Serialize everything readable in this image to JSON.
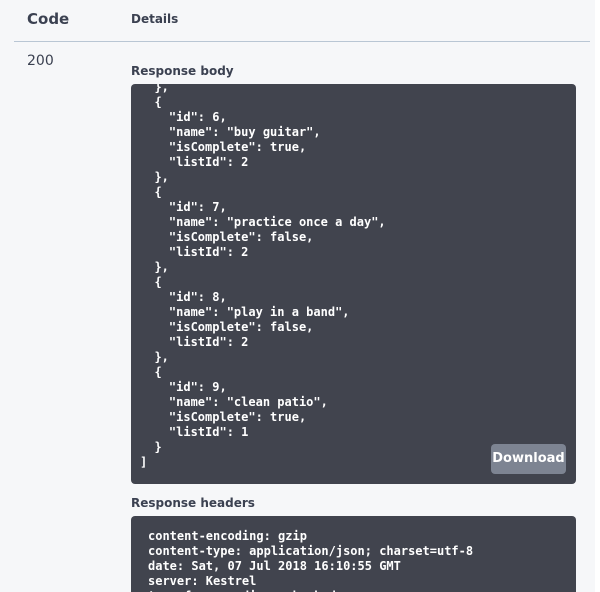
{
  "table": {
    "code_header": "Code",
    "details_header": "Details"
  },
  "response": {
    "status_code": "200",
    "body_label": "Response body",
    "body_text": "  },\n  {\n    \"id\": 6,\n    \"name\": \"buy guitar\",\n    \"isComplete\": true,\n    \"listId\": 2\n  },\n  {\n    \"id\": 7,\n    \"name\": \"practice once a day\",\n    \"isComplete\": false,\n    \"listId\": 2\n  },\n  {\n    \"id\": 8,\n    \"name\": \"play in a band\",\n    \"isComplete\": false,\n    \"listId\": 2\n  },\n  {\n    \"id\": 9,\n    \"name\": \"clean patio\",\n    \"isComplete\": true,\n    \"listId\": 1\n  }\n]",
    "download_label": "Download",
    "headers_label": "Response headers",
    "headers_text": "content-encoding: gzip\ncontent-type: application/json; charset=utf-8\ndate: Sat, 07 Jul 2018 16:10:55 GMT\nserver: Kestrel\ntransfer-encoding: chunked"
  },
  "colors": {
    "page_background": "#f6f7f9",
    "text": "#3b4151",
    "code_background": "#41444e",
    "button_background": "#7d8492",
    "rule": "#b9c6d4"
  }
}
